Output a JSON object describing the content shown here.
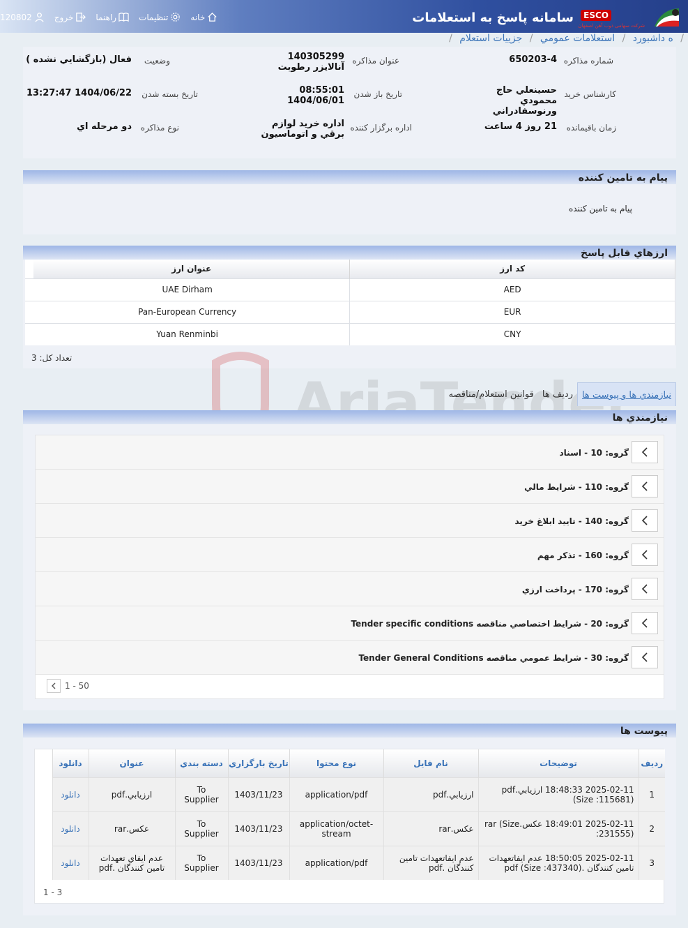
{
  "header": {
    "app_title": "سامانه پاسخ به استعلامات",
    "brand": "ESCO",
    "brand_sub": "شرکت سهامی ذوب آهن اصفهان",
    "nav": {
      "home": "خانه",
      "settings": "تنظیمات",
      "help": "راهنما",
      "logout": "خروج",
      "user": "120802"
    }
  },
  "breadcrumb": [
    "ه داشبورد",
    "استعلامات عمومي",
    "جزييات استعلام"
  ],
  "info": {
    "negotiation_number_label": "شماره مذاکره",
    "negotiation_number": "650203-4",
    "negotiation_title_label": "عنوان مذاکره",
    "negotiation_title": "140305299 آنالايزر رطوبت",
    "status_label": "وضعيت",
    "status": "فعال (بازگشايي نشده )",
    "buyer_label": "کارشناس خريد",
    "buyer": "حسينعلي حاج محمودي ورنوسفادراني",
    "open_date_label": "تاريخ باز شدن",
    "open_date": "08:55:01 1404/06/01",
    "close_date_label": "تاريخ بسته شدن",
    "close_date": "1404/06/22 13:27:47",
    "remaining_label": "زمان باقيمانده",
    "remaining": "21 روز 4 ساعت",
    "organizer_label": "اداره برگزار کننده",
    "organizer": "اداره خريد لوازم برقي و اتوماسيون",
    "type_label": "نوع مذاکره",
    "type": "دو مرحله اي"
  },
  "message_panel": {
    "title": "پيام به تامين کننده",
    "body": "پيام به تامين کننده"
  },
  "currencies": {
    "title": "ارزهاي قابل پاسخ",
    "col_code": "کد ارز",
    "col_name": "عنوان ارز",
    "rows": [
      {
        "code": "AED",
        "name": "UAE Dirham"
      },
      {
        "code": "EUR",
        "name": "Pan-European Currency"
      },
      {
        "code": "CNY",
        "name": "Yuan Renminbi"
      }
    ],
    "total": "تعداد کل: 3"
  },
  "tabs": [
    "نيازمندي ها و پيوست ها",
    "رديف ها",
    "قوانين استعلام/مناقصه"
  ],
  "requirements": {
    "title": "نيازمندي ها",
    "groups": [
      "گروه: 10 - اسناد",
      "گروه: 110 - شرايط مالي",
      "گروه: 140 - تاييد ابلاغ خريد",
      "گروه: 160 - تذکر مهم",
      "گروه: 170 - پرداخت ارزي",
      "گروه: 20 - شرايط اختصاصي مناقصه Tender specific conditions",
      "گروه: 30 - شرايط عمومي مناقصه Tender General Conditions"
    ],
    "pager": "1 - 50"
  },
  "attachments": {
    "title": "پيوست ها",
    "columns": [
      "رديف",
      "توضيحات",
      "نام فايل",
      "نوع محتوا",
      "تاريخ بارگزاري",
      "دسته بندي",
      "عنوان",
      "دانلود"
    ],
    "rows": [
      {
        "idx": "1",
        "desc": "2025-02-11 18:48:33 ارزيابي.pdf (Size :115681)",
        "file": "ارزيابي.pdf",
        "type": "application/pdf",
        "date": "1403/11/23",
        "cat": "To Supplier",
        "title": "ارزيابي.pdf",
        "dl": "دانلود"
      },
      {
        "idx": "2",
        "desc": "2025-02-11 18:49:01 عکس.rar (Size :231555)",
        "file": "عکس.rar",
        "type": "application/octet-stream",
        "date": "1403/11/23",
        "cat": "To Supplier",
        "title": "عکس.rar",
        "dl": "دانلود"
      },
      {
        "idx": "3",
        "desc": "2025-02-11 18:50:05 عدم ايفاتعهدات تامين کنندگان .pdf (Size :437340)",
        "file": "عدم ايفاتعهدات تامين کنندگان .pdf",
        "type": "application/pdf",
        "date": "1403/11/23",
        "cat": "To Supplier",
        "title": "عدم ايفاي تعهدات تامين کنندگان .pdf",
        "dl": "دانلود"
      }
    ],
    "total": "1 - 3"
  },
  "watermark": "AriaTender.neT"
}
